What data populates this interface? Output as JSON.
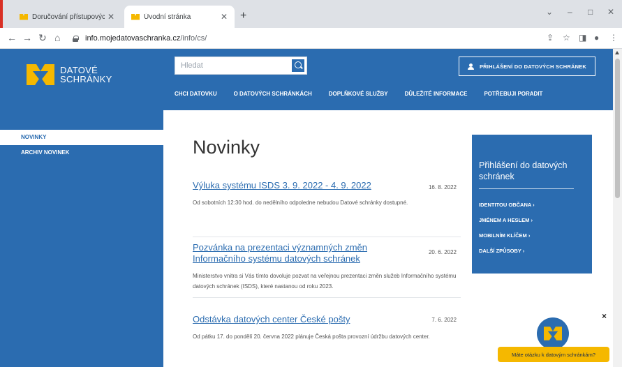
{
  "browser": {
    "tabs": [
      {
        "title": "Doručování přístupových údajů",
        "active": false
      },
      {
        "title": "Úvodní stránka",
        "active": true
      }
    ],
    "new_tab_symbol": "+",
    "url_host": "info.mojedatovaschranka.cz",
    "url_path": "/info/cs/",
    "nav_icons": [
      "back-arrow-icon",
      "forward-arrow-icon",
      "reload-icon",
      "home-icon"
    ],
    "toolbar_icons": [
      "share-icon",
      "bookmark-star-icon",
      "sidebar-icon",
      "profile-icon",
      "menu-dots-icon"
    ]
  },
  "header": {
    "logo_line1": "DATOVÉ",
    "logo_line2": "SCHRÁNKY",
    "search_placeholder": "Hledat",
    "login_button": "PŘIHLÁŠENÍ DO DATOVÝCH SCHRÁNEK",
    "nav": [
      "CHCI DATOVKU",
      "O DATOVÝCH SCHRÁNKÁCH",
      "DOPLŇKOVÉ SLUŽBY",
      "DŮLEŽITÉ INFORMACE",
      "POTŘEBUJI PORADIT"
    ]
  },
  "sidebar": {
    "items": [
      {
        "label": "NOVINKY",
        "active": true
      },
      {
        "label": "ARCHIV NOVINEK",
        "active": false
      }
    ]
  },
  "main": {
    "title": "Novinky",
    "articles": [
      {
        "title": "Výluka systému ISDS 3. 9. 2022 - 4. 9. 2022",
        "date": "16. 8. 2022",
        "text": "Od sobotních 12:30 hod. do nedělního odpoledne nebudou Datové schránky dostupné."
      },
      {
        "title": "Pozvánka na prezentaci významných změn Informačního systému datových schránek",
        "date": "20. 6. 2022",
        "text": "Ministerstvo vnitra si Vás tímto dovoluje pozvat na veřejnou prezentaci změn služeb Informačního systému datových schránek (ISDS), které nastanou od roku 2023."
      },
      {
        "title": "Odstávka datových center České pošty",
        "date": "7. 6. 2022",
        "text": "Od pátku 17. do pondělí 20. června 2022 plánuje Česká pošta provozní údržbu datových center."
      }
    ]
  },
  "login_box": {
    "title": "Přihlášení do datových schránek",
    "links": [
      "IDENTITOU OBČANA ›",
      "JMÉNEM A HESLEM ›",
      "MOBILNÍM KLÍČEM ›",
      "DALŠÍ ZPŮSOBY ›"
    ]
  },
  "chat": {
    "bubble_text": "Máte otázku k datovým schránkám?",
    "close_symbol": "×"
  },
  "colors": {
    "brand_blue": "#2b6cb0",
    "accent_yellow": "#f5b800"
  }
}
